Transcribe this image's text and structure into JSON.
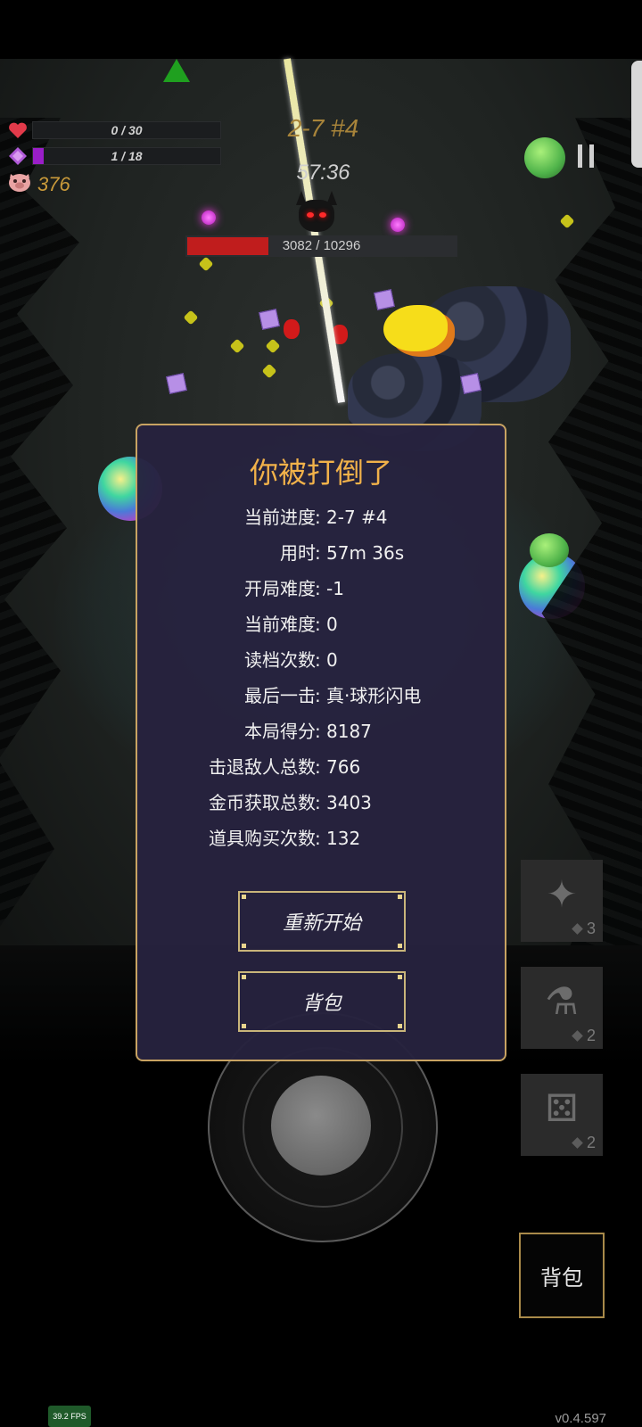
{
  "hud": {
    "health": {
      "text": "0 / 30",
      "current": 0,
      "max": 30,
      "color": "#e23a4a"
    },
    "xp": {
      "text": "1 / 18",
      "current": 1,
      "max": 18,
      "color": "#9a1ec8"
    },
    "gold": "376",
    "stage": "2-7 #4",
    "timer": "57:36",
    "boss": {
      "text": "3082 / 10296",
      "current": 3082,
      "max": 10296,
      "color": "#c01d1d"
    }
  },
  "icons": {
    "heart": "heart-icon",
    "xp_gem": "xp-gem-icon",
    "gold": "pig-icon",
    "pause": "pause-icon",
    "objective": "objective-arrow-icon"
  },
  "dialog": {
    "title": "你被打倒了",
    "stats": [
      {
        "label": "当前进度",
        "value": "2-7 #4"
      },
      {
        "label": "用时",
        "value": "57m 36s"
      },
      {
        "label": "开局难度",
        "value": "-1"
      },
      {
        "label": "当前难度",
        "value": "0"
      },
      {
        "label": "读档次数",
        "value": "0"
      },
      {
        "label": "最后一击",
        "value": "真·球形闪电"
      },
      {
        "label": "本局得分",
        "value": "8187"
      },
      {
        "label": "击退敌人总数",
        "value": "766"
      },
      {
        "label": "金币获取总数",
        "value": "3403"
      },
      {
        "label": "道具购买次数",
        "value": "132"
      }
    ],
    "colon": ":",
    "restart_label": "重新开始",
    "bag_label": "背包"
  },
  "items": [
    {
      "icon": "shuriken-icon",
      "count": "3"
    },
    {
      "icon": "potion-icon",
      "count": "2"
    },
    {
      "icon": "dice-icon",
      "count": "2"
    }
  ],
  "bag_button": "背包",
  "fps": "39.2 FPS",
  "version": "v0.4.597"
}
